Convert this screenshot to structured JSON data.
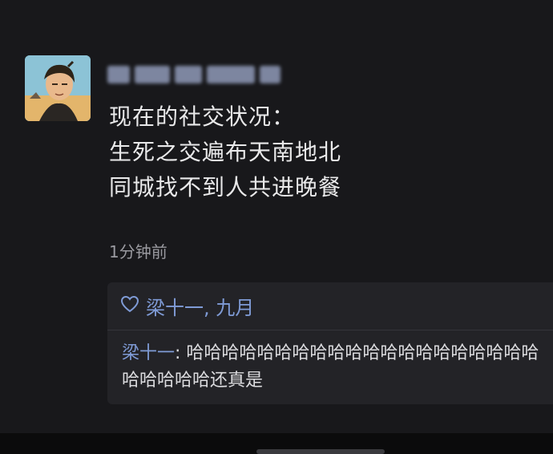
{
  "post": {
    "avatar_icon": "user-avatar-anime-character",
    "content_lines": [
      "现在的社交状况：",
      "生死之交遍布天南地北",
      "同城找不到人共进晚餐"
    ],
    "timestamp": "1分钟前"
  },
  "interaction": {
    "like_icon": "heart-outline-icon",
    "likes": "梁十一, 九月",
    "comment": {
      "author": "梁十一",
      "separator": ": ",
      "text": "哈哈哈哈哈哈哈哈哈哈哈哈哈哈哈哈哈哈哈哈哈哈哈哈哈还真是"
    }
  },
  "colors": {
    "background": "#18181b",
    "link": "#7f9bd6",
    "text": "#e9e9ea",
    "muted": "#9a9aa0"
  }
}
